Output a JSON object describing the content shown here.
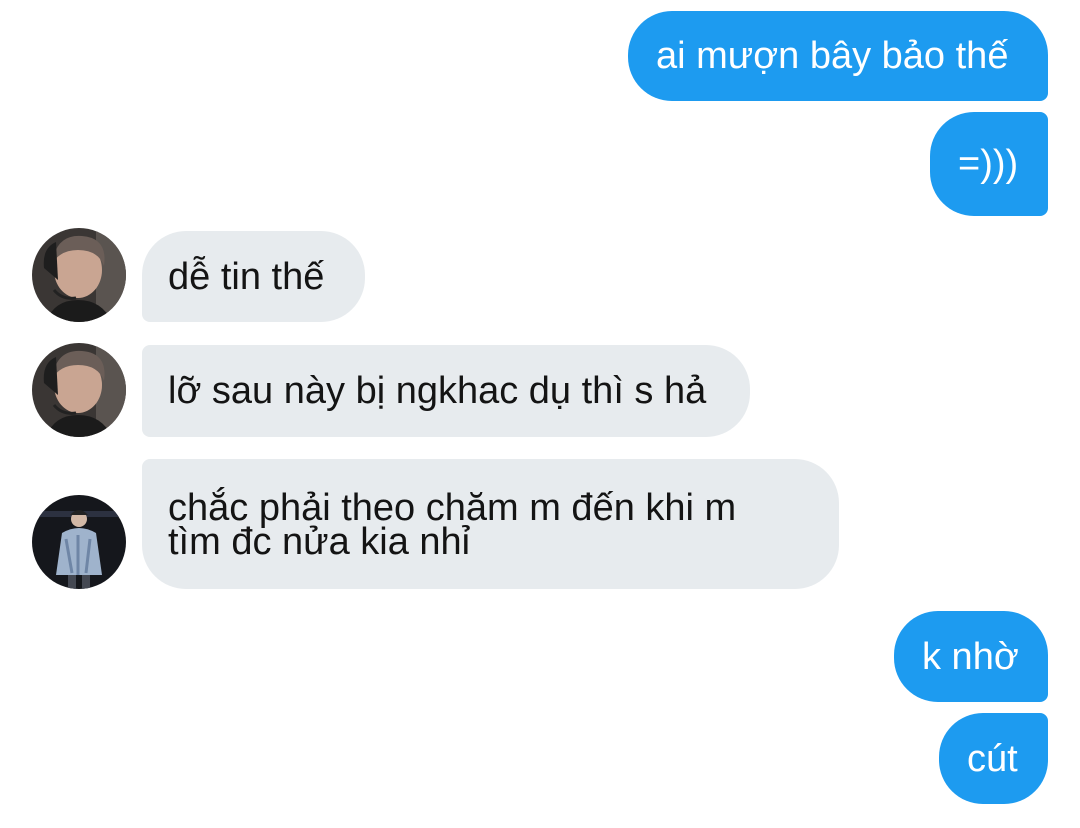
{
  "messages": [
    {
      "side": "out",
      "text": "ai mượn bây bảo thế"
    },
    {
      "side": "out",
      "text": "=)))"
    },
    {
      "side": "in",
      "text": "dễ tin thế",
      "avatar": "avatar-user-a"
    },
    {
      "side": "in",
      "text": "lỡ sau này bị ngkhac dụ thì s hả",
      "avatar": "avatar-user-a"
    },
    {
      "side": "in",
      "text": "chắc phải theo chăm m đến khi m tìm đc nửa kia nhỉ",
      "avatar": "avatar-user-b"
    },
    {
      "side": "out",
      "text": "k nhờ"
    },
    {
      "side": "out",
      "text": "cút"
    }
  ],
  "colors": {
    "outgoing_bubble": "#1d9bf0",
    "incoming_bubble": "#e7ebee",
    "outgoing_text": "#ffffff",
    "incoming_text": "#141414",
    "background": "#ffffff"
  }
}
